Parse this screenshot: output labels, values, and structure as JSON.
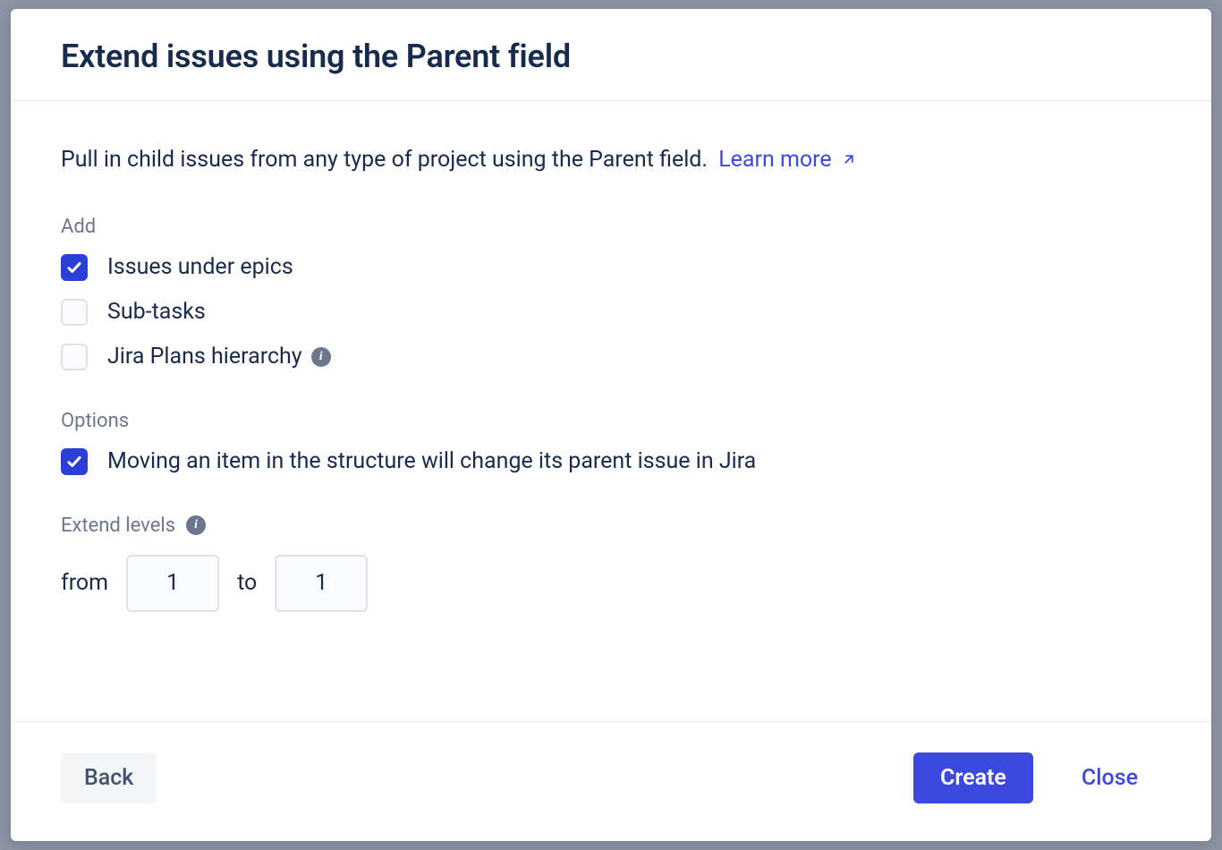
{
  "header": {
    "title": "Extend issues using the Parent field"
  },
  "description": {
    "text": "Pull in child issues from any type of project using the Parent field.",
    "learn_more": "Learn more"
  },
  "add_section": {
    "label": "Add",
    "items": [
      {
        "label": "Issues under epics",
        "checked": true,
        "info": false
      },
      {
        "label": "Sub-tasks",
        "checked": false,
        "info": false
      },
      {
        "label": "Jira Plans hierarchy",
        "checked": false,
        "info": true
      }
    ]
  },
  "options_section": {
    "label": "Options",
    "items": [
      {
        "label": "Moving an item in the structure will change its parent issue in Jira",
        "checked": true
      }
    ]
  },
  "extend_levels": {
    "label": "Extend levels",
    "from_label": "from",
    "from_value": "1",
    "to_label": "to",
    "to_value": "1"
  },
  "footer": {
    "back": "Back",
    "create": "Create",
    "close": "Close"
  }
}
